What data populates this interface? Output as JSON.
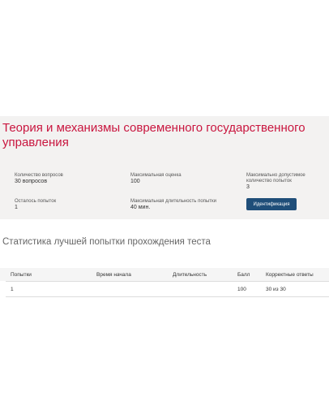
{
  "test": {
    "title": "Теория и механизмы современного государственного управления"
  },
  "info": {
    "questions_label": "Количество вопросов",
    "questions_value": "30 вопросов",
    "max_score_label": "Максимальная оценка",
    "max_score_value": "100",
    "max_attempts_label": "Максимально допустимое количество попыток",
    "max_attempts_value": "3",
    "remaining_label": "Осталось попыток",
    "remaining_value": "1",
    "max_duration_label": "Максимальная длительность попытки",
    "max_duration_value": "40 мин."
  },
  "actions": {
    "identify_label": "Идентификация"
  },
  "stats": {
    "heading": "Статистика лучшей попытки прохождения теста",
    "columns": {
      "attempts": "Попытки",
      "start_time": "Время начала",
      "duration": "Длительность",
      "score": "Балл",
      "correct": "Корректные ответы"
    },
    "rows": [
      {
        "attempt": "1",
        "start_time": "",
        "duration": "",
        "score": "100",
        "correct": "30 из 30"
      }
    ]
  },
  "colors": {
    "title": "#c9163f",
    "button": "#1f4e79",
    "panel": "#f3f2f1"
  }
}
